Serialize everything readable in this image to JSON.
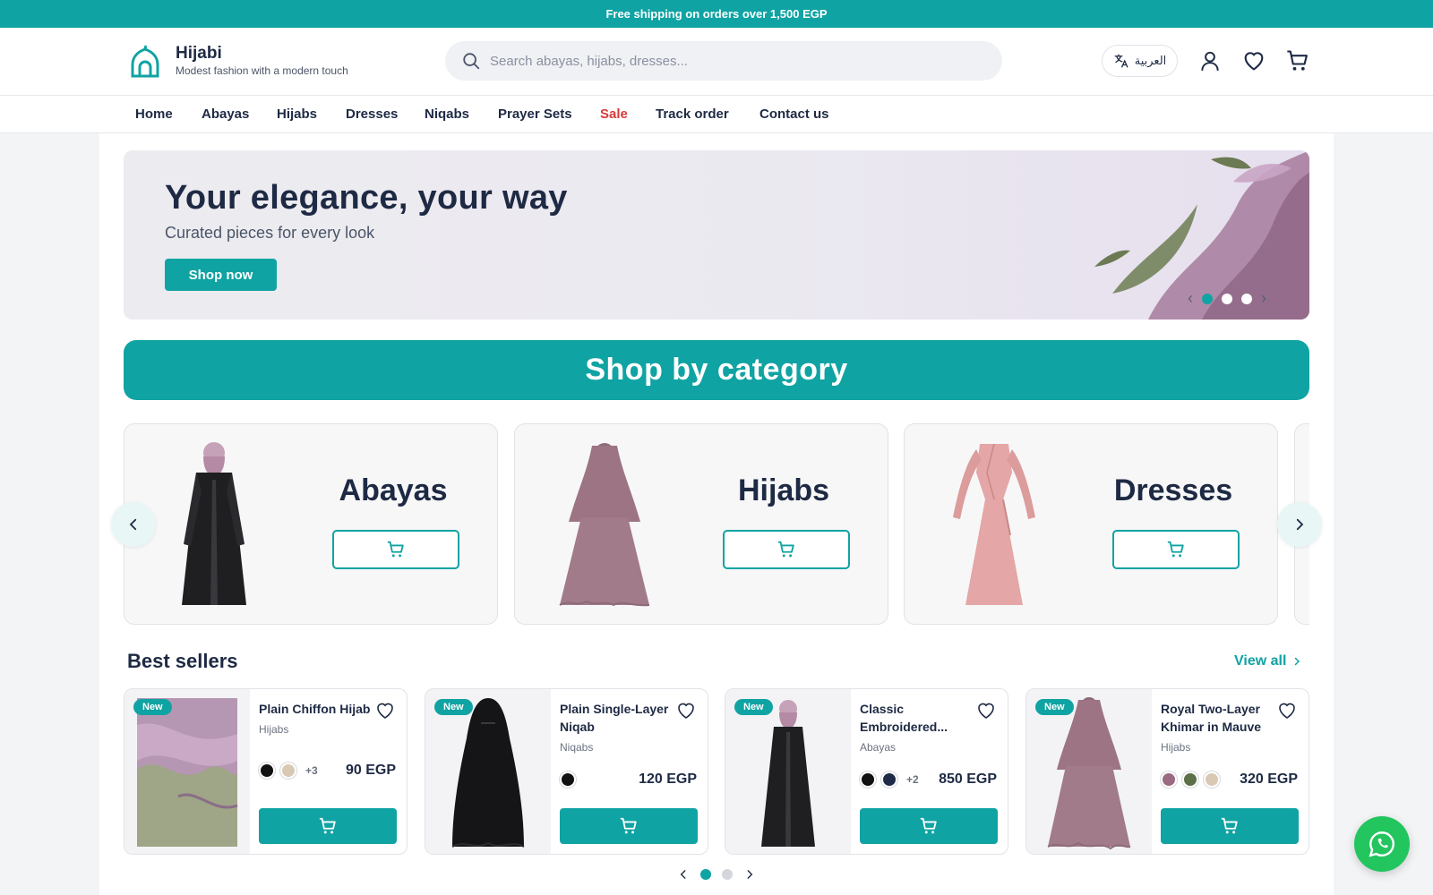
{
  "topbar": {
    "text": "Free shipping on orders over 1,500 EGP"
  },
  "brand": {
    "name": "Hijabi",
    "tagline": "Modest fashion with a modern touch"
  },
  "search": {
    "placeholder": "Search abayas, hijabs, dresses..."
  },
  "header": {
    "language_label": "العربية"
  },
  "nav": {
    "items": [
      {
        "label": "Home"
      },
      {
        "label": "Abayas"
      },
      {
        "label": "Hijabs"
      },
      {
        "label": "Dresses"
      },
      {
        "label": "Niqabs"
      },
      {
        "label": "Prayer Sets"
      },
      {
        "label": "Sale"
      },
      {
        "label": "Track order"
      },
      {
        "label": "Contact us"
      }
    ],
    "sale_color": "#d93a3a"
  },
  "hero": {
    "title": "Your elegance, your way",
    "subtitle": "Curated pieces for every look",
    "cta": "Shop now",
    "slides": 3,
    "active_slide": 1
  },
  "categories": {
    "heading": "Shop by category",
    "items": [
      {
        "title": "Abayas",
        "icon": "abaya-image"
      },
      {
        "title": "Hijabs",
        "icon": "hijab-image"
      },
      {
        "title": "Dresses",
        "icon": "dress-image"
      }
    ]
  },
  "best_sellers": {
    "heading": "Best sellers",
    "view_all": "View all",
    "products": [
      {
        "badge": "New",
        "name": "Plain Chiffon Hijab",
        "category": "Hijabs",
        "swatches": [
          "#111111",
          "#d9c9b4"
        ],
        "more": "+3",
        "price": "90 EGP"
      },
      {
        "badge": "New",
        "name": "Plain Single-Layer Niqab",
        "category": "Niqabs",
        "swatches": [
          "#111111"
        ],
        "more": "",
        "price": "120 EGP"
      },
      {
        "badge": "New",
        "name": "Classic Embroidered...",
        "category": "Abayas",
        "swatches": [
          "#111111",
          "#1f2a48"
        ],
        "more": "+2",
        "price": "850 EGP"
      },
      {
        "badge": "New",
        "name": "Royal Two-Layer Khimar in Mauve",
        "category": "Hijabs",
        "swatches": [
          "#9a6a82",
          "#5b7048",
          "#d9c9b4"
        ],
        "more": "",
        "price": "320 EGP"
      }
    ],
    "pages": 2,
    "active_page": 1
  },
  "colors": {
    "accent": "#10a3a3",
    "text": "#1e2a44",
    "whatsapp": "#22c55e"
  }
}
